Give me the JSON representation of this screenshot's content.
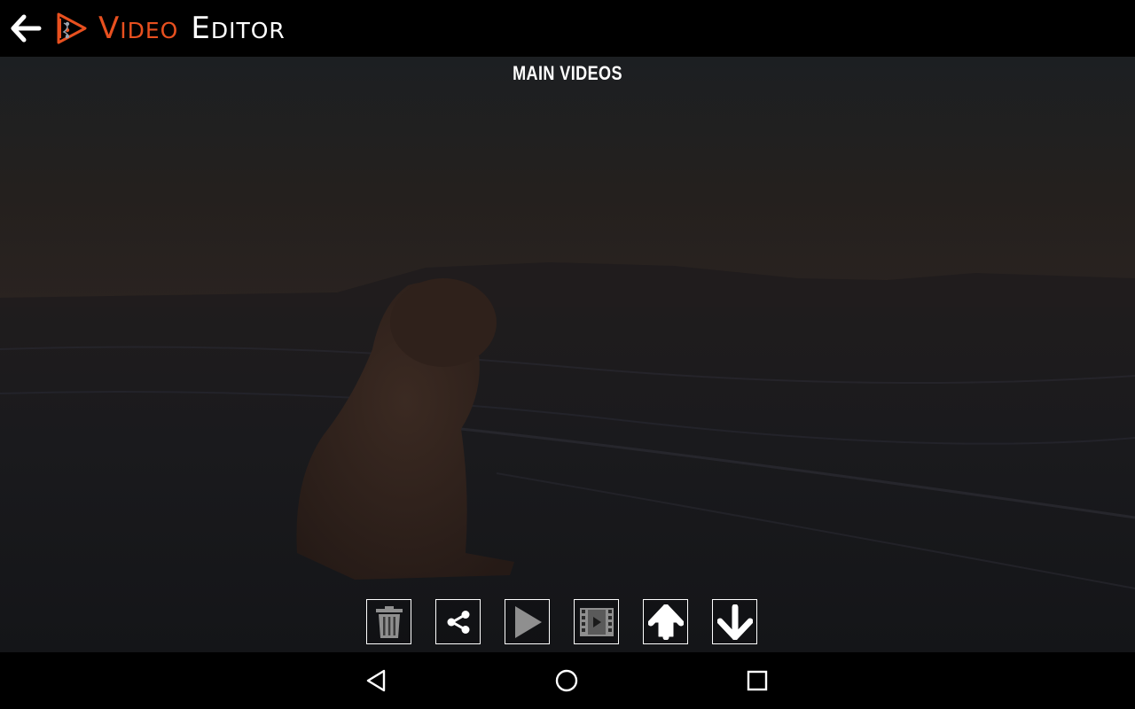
{
  "app_bar": {
    "title_part1_cap": "V",
    "title_part1_rest": "IDEO",
    "title_part2_cap": "E",
    "title_part2_rest": "DITOR",
    "back_icon": "arrow-left-icon",
    "logo_icon": "video-editor-logo-icon"
  },
  "preview": {
    "section_title": "MAIN VIDEOS"
  },
  "actions": [
    {
      "name": "delete",
      "icon": "trash-icon"
    },
    {
      "name": "share",
      "icon": "share-icon"
    },
    {
      "name": "play",
      "icon": "play-icon"
    },
    {
      "name": "video-clip",
      "icon": "film-icon"
    },
    {
      "name": "move-up",
      "icon": "arrow-up-icon"
    },
    {
      "name": "move-down",
      "icon": "arrow-down-icon"
    }
  ],
  "colors": {
    "accent": "#e8501f",
    "title_secondary": "#ffffff",
    "bar_background": "#000000"
  },
  "nav": {
    "back_icon": "triangle-back-icon",
    "home_icon": "circle-home-icon",
    "recents_icon": "square-recents-icon"
  }
}
